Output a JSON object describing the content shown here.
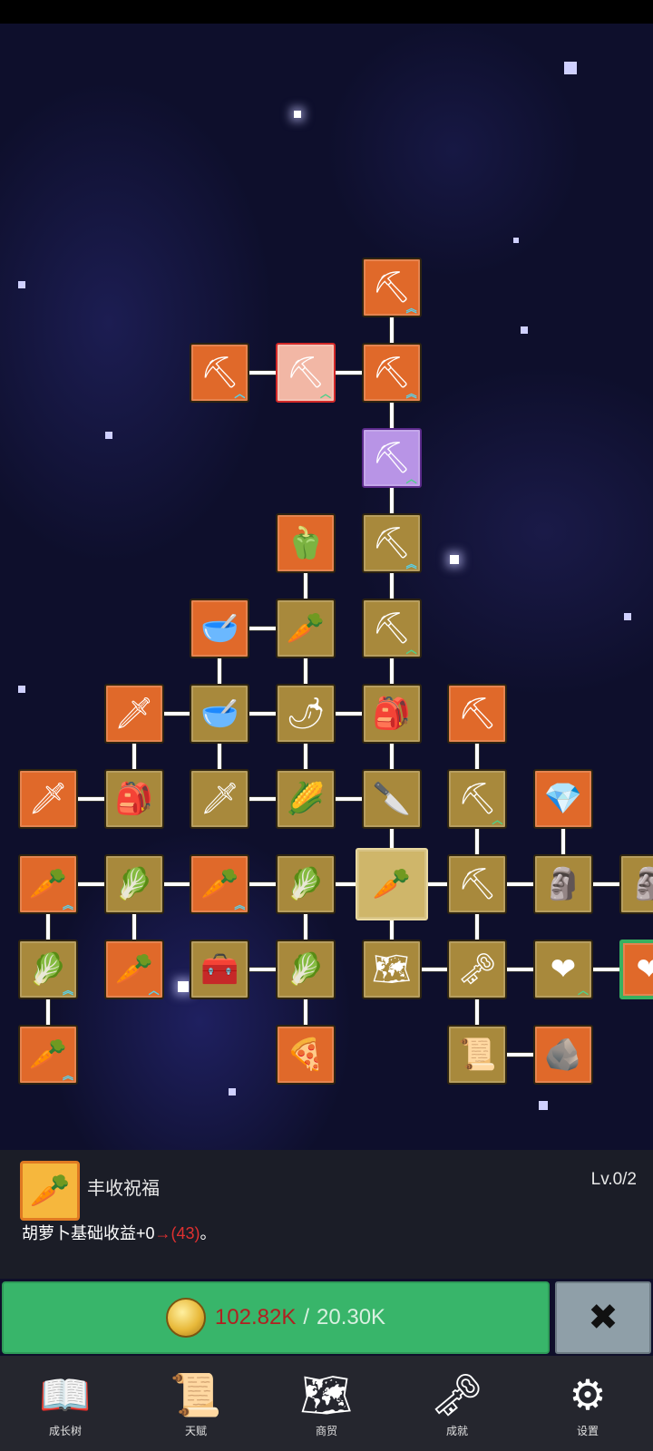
{
  "tree": {
    "nodes": [
      {
        "id": "n1",
        "style": "orange",
        "icon": "shovel-icon",
        "glyph": "⛏",
        "lv": "︽"
      },
      {
        "id": "n2",
        "style": "orange",
        "icon": "shovel-icon",
        "glyph": "⛏",
        "lv": "︿"
      },
      {
        "id": "n3",
        "style": "pink",
        "icon": "shovel-icon",
        "glyph": "⛏",
        "lv": "︿"
      },
      {
        "id": "n4",
        "style": "orange",
        "icon": "shovel-icon",
        "glyph": "⛏",
        "lv": "︽"
      },
      {
        "id": "n5",
        "style": "purple",
        "icon": "shovel-icon",
        "glyph": "⛏",
        "lv": "︿"
      },
      {
        "id": "n6",
        "style": "orange",
        "icon": "pepper-icon",
        "glyph": "🫑",
        "lv": ""
      },
      {
        "id": "n7",
        "style": "brown",
        "icon": "shovel-icon",
        "glyph": "⛏",
        "lv": "︽"
      },
      {
        "id": "n8",
        "style": "orange",
        "icon": "bowl-icon",
        "glyph": "🥣",
        "lv": ""
      },
      {
        "id": "n9",
        "style": "brown",
        "icon": "radish-icon",
        "glyph": "🥕",
        "lv": ""
      },
      {
        "id": "n10",
        "style": "brown",
        "icon": "shovel-icon",
        "glyph": "⛏",
        "lv": "︿"
      },
      {
        "id": "n11",
        "style": "orange",
        "icon": "sword-icon",
        "glyph": "🗡",
        "lv": ""
      },
      {
        "id": "n12",
        "style": "brown",
        "icon": "bowl-icon",
        "glyph": "🥣",
        "lv": ""
      },
      {
        "id": "n13",
        "style": "brown",
        "icon": "chili-icon",
        "glyph": "🌶",
        "lv": ""
      },
      {
        "id": "n14",
        "style": "brown",
        "icon": "backpack-icon",
        "glyph": "🎒",
        "lv": ""
      },
      {
        "id": "n15",
        "style": "orange",
        "icon": "pickaxe-icon",
        "glyph": "⛏",
        "lv": ""
      },
      {
        "id": "n16",
        "style": "orange",
        "icon": "sword-icon",
        "glyph": "🗡",
        "lv": ""
      },
      {
        "id": "n17",
        "style": "brown",
        "icon": "backpack-icon",
        "glyph": "🎒",
        "lv": ""
      },
      {
        "id": "n18",
        "style": "brown",
        "icon": "sword-icon",
        "glyph": "🗡",
        "lv": ""
      },
      {
        "id": "n19",
        "style": "brown",
        "icon": "corn-icon",
        "glyph": "🌽",
        "lv": ""
      },
      {
        "id": "n20",
        "style": "brown",
        "icon": "knife-icon",
        "glyph": "🔪",
        "lv": ""
      },
      {
        "id": "n21",
        "style": "brown",
        "icon": "pickaxe-icon",
        "glyph": "⛏",
        "lv": "︿"
      },
      {
        "id": "n22",
        "style": "orange",
        "icon": "crystal-icon",
        "glyph": "💎",
        "lv": ""
      },
      {
        "id": "n23",
        "style": "orange",
        "icon": "carrot-icon",
        "glyph": "🥕",
        "lv": "︽"
      },
      {
        "id": "n24",
        "style": "brown",
        "icon": "cabbage-icon",
        "glyph": "🥬",
        "lv": ""
      },
      {
        "id": "n25",
        "style": "orange",
        "icon": "carrot-icon",
        "glyph": "🥕",
        "lv": "︽"
      },
      {
        "id": "n26",
        "style": "brown",
        "icon": "cabbage-icon",
        "glyph": "🥬",
        "lv": ""
      },
      {
        "id": "n27",
        "style": "selected",
        "icon": "carrot-icon",
        "glyph": "🥕",
        "lv": ""
      },
      {
        "id": "n28",
        "style": "brown",
        "icon": "pickaxe-icon",
        "glyph": "⛏",
        "lv": ""
      },
      {
        "id": "n29",
        "style": "brown",
        "icon": "statue-icon",
        "glyph": "🗿",
        "lv": ""
      },
      {
        "id": "n30",
        "style": "brown",
        "icon": "statue-icon",
        "glyph": "🗿",
        "lv": ""
      },
      {
        "id": "n31",
        "style": "brown",
        "icon": "cabbage-icon",
        "glyph": "🥬",
        "lv": "︽"
      },
      {
        "id": "n32",
        "style": "orange",
        "icon": "carrot-icon",
        "glyph": "🥕",
        "lv": "︿"
      },
      {
        "id": "n33",
        "style": "brown",
        "icon": "chest-icon",
        "glyph": "🧰",
        "lv": ""
      },
      {
        "id": "n34",
        "style": "brown",
        "icon": "leek-icon",
        "glyph": "🥬",
        "lv": ""
      },
      {
        "id": "n35",
        "style": "brown",
        "icon": "map-icon",
        "glyph": "🗺",
        "lv": ""
      },
      {
        "id": "n36",
        "style": "brown",
        "icon": "key-icon",
        "glyph": "🗝",
        "lv": ""
      },
      {
        "id": "n37",
        "style": "brown",
        "icon": "heart-icon",
        "glyph": "❤",
        "lv": "︿"
      },
      {
        "id": "n38",
        "style": "green-frame",
        "icon": "heart-icon",
        "glyph": "❤",
        "lv": "︿"
      },
      {
        "id": "n39",
        "style": "orange",
        "icon": "carrot-icon",
        "glyph": "🥕",
        "lv": "︽"
      },
      {
        "id": "n40",
        "style": "orange",
        "icon": "pizza-icon",
        "glyph": "🍕",
        "lv": ""
      },
      {
        "id": "n41",
        "style": "brown",
        "icon": "scroll-icon",
        "glyph": "📜",
        "lv": ""
      },
      {
        "id": "n42",
        "style": "orange",
        "icon": "ore-icon",
        "glyph": "🪨",
        "lv": ""
      }
    ]
  },
  "info": {
    "icon": "carrot-icon",
    "glyph": "🥕",
    "title": "丰收祝福",
    "level": "Lv.0/2",
    "desc_prefix": "胡萝卜基础收益+0",
    "desc_arrow": "→",
    "desc_value": "(43)",
    "desc_suffix": "。"
  },
  "upgrade": {
    "coin_icon": "coin-icon",
    "current": "102.82K",
    "separator": "/",
    "required": "20.30K",
    "current_color": "#b02020"
  },
  "close": {
    "icon": "close-icon",
    "glyph": "✖"
  },
  "nav": [
    {
      "label": "成长树",
      "icon": "book-icon",
      "glyph": "📖"
    },
    {
      "label": "天赋",
      "icon": "scroll-icon",
      "glyph": "📜"
    },
    {
      "label": "商贸",
      "icon": "map-icon",
      "glyph": "🗺"
    },
    {
      "label": "成就",
      "icon": "key-icon",
      "glyph": "🗝"
    },
    {
      "label": "设置",
      "icon": "gear-icon",
      "glyph": "⚙"
    }
  ],
  "colors": {
    "orange_tile": "#e0692a",
    "brown_tile": "#a8893c",
    "button_green": "#38b56a",
    "close_gray": "#8f9fa8"
  }
}
